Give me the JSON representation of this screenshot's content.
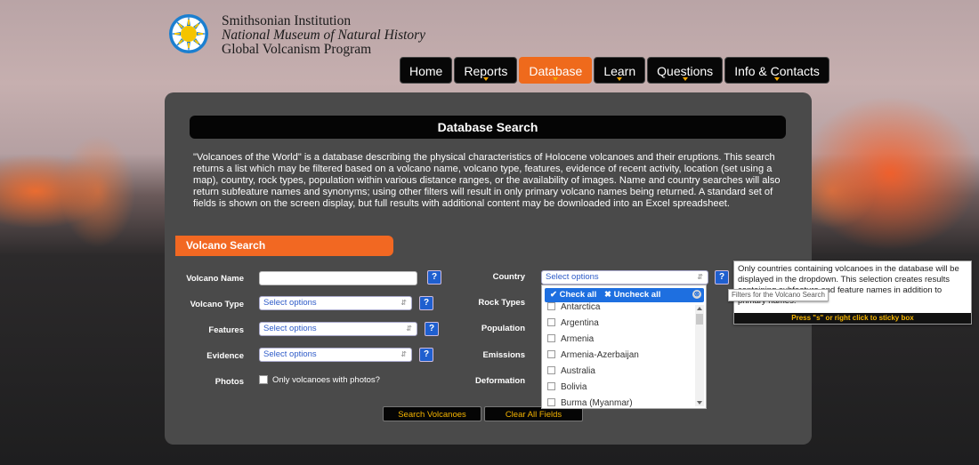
{
  "header": {
    "line1": "Smithsonian Institution",
    "line2": "National Museum of Natural History",
    "line3": "Global Volcanism Program",
    "logo_icon": "smithsonian-sunburst-icon"
  },
  "nav": {
    "home": "Home",
    "reports": "Reports",
    "database": "Database",
    "learn": "Learn",
    "questions": "Questions",
    "info": "Info & Contacts"
  },
  "panel": {
    "title": "Database Search",
    "description": "\"Volcanoes of the World\" is a database describing the physical characteristics of Holocene volcanoes and their eruptions. This search returns a list which may be filtered based on a volcano name, volcano type, features, evidence of recent activity, location (set using a map), country, rock types, population within various distance ranges, or the availability of images. Name and country searches will also return subfeature names and synonyms; using other filters will result in only primary volcano names being returned. A standard set of fields is shown on the screen display, but full results with additional content may be downloaded into an Excel spreadsheet.",
    "section_title": "Volcano Search"
  },
  "form": {
    "volcano_name_label": "Volcano Name",
    "volcano_name_value": "",
    "volcano_type_label": "Volcano Type",
    "volcano_type_value": "Select options",
    "features_label": "Features",
    "features_value": "Select options",
    "evidence_label": "Evidence",
    "evidence_value": "Select options",
    "photos_label": "Photos",
    "photos_option": "Only volcanoes with photos?",
    "country_label": "Country",
    "country_value": "Select options",
    "rock_types_label": "Rock Types",
    "population_label": "Population",
    "emissions_label": "Emissions",
    "deformation_label": "Deformation",
    "help": "?",
    "search_button": "Search Volcanoes",
    "clear_button": "Clear All Fields"
  },
  "dropdown": {
    "check_all": "✔ Check all",
    "uncheck_all": "✖ Uncheck all",
    "close": "⊗",
    "items": [
      "Antarctica",
      "Argentina",
      "Armenia",
      "Armenia-Azerbaijan",
      "Australia",
      "Bolivia",
      "Burma (Myanmar)"
    ]
  },
  "popup": {
    "text": "Only countries containing volcanoes in the database will be displayed in the dropdown.  This selection creates results containing subfeature and feature names in addition to primary names.",
    "footer": "Press \"s\" or right click to sticky box",
    "tooltip": "Filters for the Volcano Search"
  },
  "colors": {
    "accent": "#ef6a1c",
    "nav_bg": "#070707",
    "panel_bg": "#4a4a4a",
    "button_text": "#f5b400",
    "help_blue": "#1f5fcf"
  }
}
